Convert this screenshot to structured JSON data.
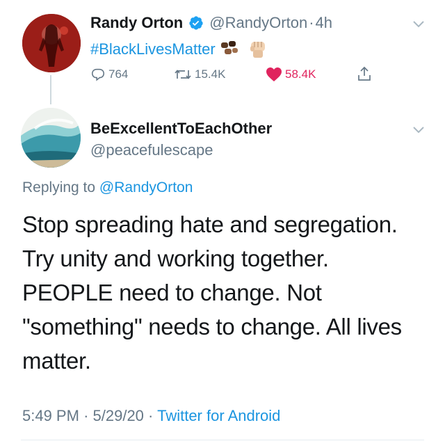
{
  "tweet1": {
    "display_name": "Randy Orton",
    "verified_icon": "verified-badge-icon",
    "handle": "@RandyOrton",
    "separator": "·",
    "time": "4h",
    "text": "#BlackLivesMatter",
    "emoji_fist": "✊🏼",
    "replies": "764",
    "retweets": "15.4K",
    "likes": "58.4K",
    "liked": true
  },
  "tweet2": {
    "display_name": "BeExcellentToEachOther",
    "handle": "@peacefulescape",
    "replying_prefix": "Replying to",
    "replying_to": "@RandyOrton",
    "text_lines": [
      "Stop spreading hate and segregation.",
      "Try unity and working together.",
      "PEOPLE need to change. Not",
      "\"something\" needs to change. All lives",
      "matter."
    ],
    "time": "5:49 PM",
    "date": "5/29/20",
    "sep1": "·",
    "sep2": "·",
    "source": "Twitter for Android"
  },
  "colors": {
    "link": "#1b95e0",
    "secondary": "#657786",
    "like": "#e0245e"
  }
}
